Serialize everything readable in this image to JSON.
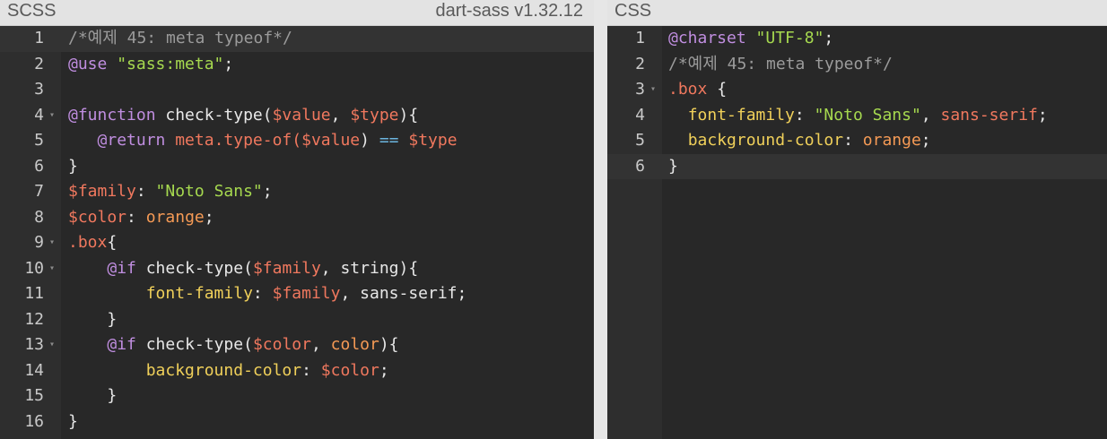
{
  "left": {
    "title": "SCSS",
    "version": "dart-sass v1.32.12",
    "lines": [
      {
        "n": "1",
        "fold": false,
        "active": true,
        "tokens": [
          [
            "/*예제 45: meta typeof*/",
            "comment"
          ]
        ]
      },
      {
        "n": "2",
        "fold": false,
        "tokens": [
          [
            "@use ",
            "keyword"
          ],
          [
            "\"sass:meta\"",
            "string"
          ],
          [
            ";",
            "plain"
          ]
        ]
      },
      {
        "n": "3",
        "fold": false,
        "tokens": []
      },
      {
        "n": "4",
        "fold": true,
        "tokens": [
          [
            "@function ",
            "keyword"
          ],
          [
            "check-type(",
            "plain"
          ],
          [
            "$value",
            "variable"
          ],
          [
            ", ",
            "plain"
          ],
          [
            "$type",
            "variable"
          ],
          [
            "){",
            "plain"
          ]
        ]
      },
      {
        "n": "5",
        "fold": false,
        "tokens": [
          [
            "   ",
            "plain"
          ],
          [
            "@return ",
            "keyword"
          ],
          [
            "meta.type-of(",
            "variable"
          ],
          [
            "$value",
            "variable"
          ],
          [
            ") ",
            "plain"
          ],
          [
            "==",
            "operator"
          ],
          [
            " ",
            "plain"
          ],
          [
            "$type",
            "variable"
          ]
        ]
      },
      {
        "n": "6",
        "fold": false,
        "tokens": [
          [
            "}",
            "plain"
          ]
        ]
      },
      {
        "n": "7",
        "fold": false,
        "tokens": [
          [
            "$family",
            "variable"
          ],
          [
            ": ",
            "plain"
          ],
          [
            "\"Noto Sans\"",
            "string"
          ],
          [
            ";",
            "plain"
          ]
        ]
      },
      {
        "n": "8",
        "fold": false,
        "tokens": [
          [
            "$color",
            "variable"
          ],
          [
            ": ",
            "plain"
          ],
          [
            "orange",
            "value"
          ],
          [
            ";",
            "plain"
          ]
        ]
      },
      {
        "n": "9",
        "fold": true,
        "tokens": [
          [
            ".box",
            "selector"
          ],
          [
            "{",
            "plain"
          ]
        ]
      },
      {
        "n": "10",
        "fold": true,
        "tokens": [
          [
            "    ",
            "plain"
          ],
          [
            "@if ",
            "keyword"
          ],
          [
            "check-type(",
            "plain"
          ],
          [
            "$family",
            "variable"
          ],
          [
            ", string){",
            "plain"
          ]
        ]
      },
      {
        "n": "11",
        "fold": false,
        "tokens": [
          [
            "        ",
            "plain"
          ],
          [
            "font-family",
            "property"
          ],
          [
            ": ",
            "plain"
          ],
          [
            "$family",
            "variable"
          ],
          [
            ", sans-serif;",
            "plain"
          ]
        ]
      },
      {
        "n": "12",
        "fold": false,
        "tokens": [
          [
            "    }",
            "plain"
          ]
        ]
      },
      {
        "n": "13",
        "fold": true,
        "tokens": [
          [
            "    ",
            "plain"
          ],
          [
            "@if ",
            "keyword"
          ],
          [
            "check-type(",
            "plain"
          ],
          [
            "$color",
            "variable"
          ],
          [
            ", ",
            "plain"
          ],
          [
            "color",
            "value"
          ],
          [
            "){",
            "plain"
          ]
        ]
      },
      {
        "n": "14",
        "fold": false,
        "tokens": [
          [
            "        ",
            "plain"
          ],
          [
            "background-color",
            "property"
          ],
          [
            ": ",
            "plain"
          ],
          [
            "$color",
            "variable"
          ],
          [
            ";",
            "plain"
          ]
        ]
      },
      {
        "n": "15",
        "fold": false,
        "tokens": [
          [
            "    }",
            "plain"
          ]
        ]
      },
      {
        "n": "16",
        "fold": false,
        "tokens": [
          [
            "}",
            "plain"
          ]
        ]
      }
    ]
  },
  "right": {
    "title": "CSS",
    "lines": [
      {
        "n": "1",
        "fold": false,
        "tokens": [
          [
            "@charset ",
            "keyword"
          ],
          [
            "\"UTF-8\"",
            "string"
          ],
          [
            ";",
            "plain"
          ]
        ]
      },
      {
        "n": "2",
        "fold": false,
        "tokens": [
          [
            "/*예제 45: meta typeof*/",
            "comment"
          ]
        ]
      },
      {
        "n": "3",
        "fold": true,
        "tokens": [
          [
            ".box",
            "selector"
          ],
          [
            " {",
            "plain"
          ]
        ]
      },
      {
        "n": "4",
        "fold": false,
        "tokens": [
          [
            "  ",
            "plain"
          ],
          [
            "font-family",
            "property"
          ],
          [
            ": ",
            "plain"
          ],
          [
            "\"Noto Sans\"",
            "string"
          ],
          [
            ", ",
            "plain"
          ],
          [
            "sans-serif",
            "variable"
          ],
          [
            ";",
            "plain"
          ]
        ]
      },
      {
        "n": "5",
        "fold": false,
        "tokens": [
          [
            "  ",
            "plain"
          ],
          [
            "background-color",
            "property"
          ],
          [
            ": ",
            "plain"
          ],
          [
            "orange",
            "value"
          ],
          [
            ";",
            "plain"
          ]
        ]
      },
      {
        "n": "6",
        "fold": false,
        "active": true,
        "tokens": [
          [
            "}",
            "plain"
          ]
        ]
      }
    ]
  },
  "icons": {
    "fold": "fold-arrow-icon"
  }
}
